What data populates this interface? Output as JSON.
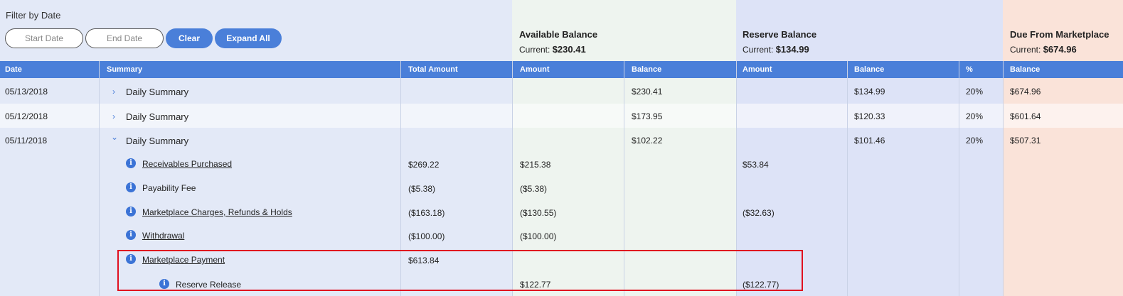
{
  "filter": {
    "title": "Filter by Date",
    "start_placeholder": "Start Date",
    "end_placeholder": "End Date",
    "clear_label": "Clear",
    "expand_label": "Expand All"
  },
  "groups": {
    "available": {
      "title": "Available Balance",
      "current_label": "Current:",
      "current_value": "$230.41"
    },
    "reserve": {
      "title": "Reserve Balance",
      "current_label": "Current:",
      "current_value": "$134.99"
    },
    "due": {
      "title": "Due From Marketplace",
      "current_label": "Current:",
      "current_value": "$674.96"
    }
  },
  "columns": {
    "date": "Date",
    "summary": "Summary",
    "total": "Total Amount",
    "avail_amount": "Amount",
    "avail_balance": "Balance",
    "res_amount": "Amount",
    "res_balance": "Balance",
    "pct": "%",
    "due_balance": "Balance"
  },
  "rows": [
    {
      "date": "05/13/2018",
      "summary": "Daily Summary",
      "avail_balance": "$230.41",
      "res_balance": "$134.99",
      "pct": "20%",
      "due_balance": "$674.96"
    },
    {
      "date": "05/12/2018",
      "summary": "Daily Summary",
      "avail_balance": "$173.95",
      "res_balance": "$120.33",
      "pct": "20%",
      "due_balance": "$601.64"
    },
    {
      "date": "05/11/2018",
      "summary": "Daily Summary",
      "avail_balance": "$102.22",
      "res_balance": "$101.46",
      "pct": "20%",
      "due_balance": "$507.31"
    }
  ],
  "details": [
    {
      "label": "Receivables Purchased",
      "total": "$269.22",
      "avail_amount": "$215.38",
      "res_amount": "$53.84"
    },
    {
      "label": "Payability Fee",
      "total": "($5.38)",
      "avail_amount": "($5.38)",
      "res_amount": ""
    },
    {
      "label": "Marketplace Charges, Refunds & Holds",
      "total": "($163.18)",
      "avail_amount": "($130.55)",
      "res_amount": "($32.63)"
    },
    {
      "label": "Withdrawal",
      "total": "($100.00)",
      "avail_amount": "($100.00)",
      "res_amount": ""
    },
    {
      "label": "Marketplace Payment",
      "total": "$613.84",
      "avail_amount": "",
      "res_amount": ""
    },
    {
      "label": "Reserve Release",
      "total": "",
      "avail_amount": "$122.77",
      "res_amount": "($122.77)"
    }
  ],
  "icons": {
    "chevron_right": "›",
    "chevron_down": "⌄",
    "info": "i"
  },
  "colors": {
    "header": "#4a7fd9",
    "available_bg": "#eef4ef",
    "reserve_bg": "#dde3f7",
    "due_bg": "#fae3d9",
    "highlight": "#e01020"
  }
}
